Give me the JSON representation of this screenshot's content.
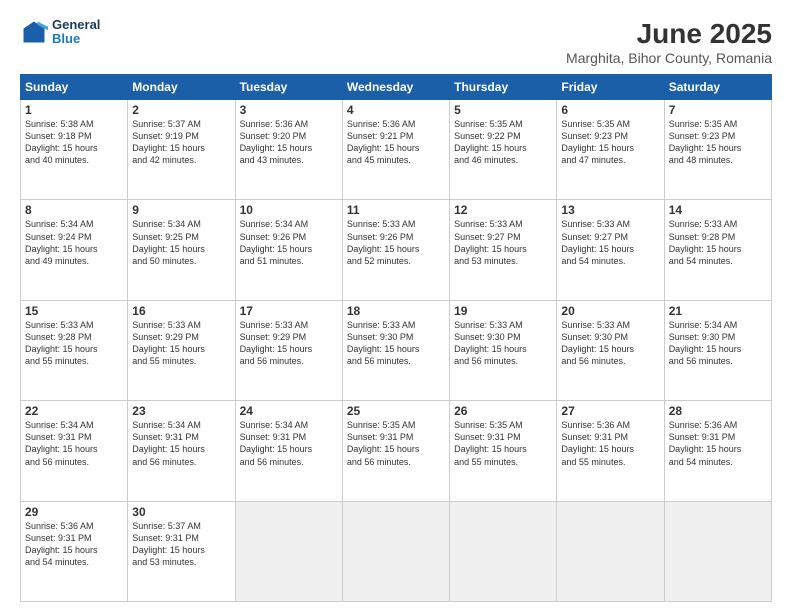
{
  "header": {
    "logo_general": "General",
    "logo_blue": "Blue",
    "title": "June 2025",
    "subtitle": "Marghita, Bihor County, Romania"
  },
  "calendar": {
    "days_of_week": [
      "Sunday",
      "Monday",
      "Tuesday",
      "Wednesday",
      "Thursday",
      "Friday",
      "Saturday"
    ],
    "weeks": [
      [
        {
          "day": "",
          "empty": true
        },
        {
          "day": "",
          "empty": true
        },
        {
          "day": "",
          "empty": true
        },
        {
          "day": "",
          "empty": true
        },
        {
          "day": "",
          "empty": true
        },
        {
          "day": "",
          "empty": true
        },
        {
          "day": "",
          "empty": true
        }
      ],
      [
        {
          "day": "1",
          "sunrise": "5:38 AM",
          "sunset": "9:18 PM",
          "daylight": "15 hours and 40 minutes."
        },
        {
          "day": "2",
          "sunrise": "5:37 AM",
          "sunset": "9:19 PM",
          "daylight": "15 hours and 42 minutes."
        },
        {
          "day": "3",
          "sunrise": "5:36 AM",
          "sunset": "9:20 PM",
          "daylight": "15 hours and 43 minutes."
        },
        {
          "day": "4",
          "sunrise": "5:36 AM",
          "sunset": "9:21 PM",
          "daylight": "15 hours and 45 minutes."
        },
        {
          "day": "5",
          "sunrise": "5:35 AM",
          "sunset": "9:22 PM",
          "daylight": "15 hours and 46 minutes."
        },
        {
          "day": "6",
          "sunrise": "5:35 AM",
          "sunset": "9:23 PM",
          "daylight": "15 hours and 47 minutes."
        },
        {
          "day": "7",
          "sunrise": "5:35 AM",
          "sunset": "9:23 PM",
          "daylight": "15 hours and 48 minutes."
        }
      ],
      [
        {
          "day": "8",
          "sunrise": "5:34 AM",
          "sunset": "9:24 PM",
          "daylight": "15 hours and 49 minutes."
        },
        {
          "day": "9",
          "sunrise": "5:34 AM",
          "sunset": "9:25 PM",
          "daylight": "15 hours and 50 minutes."
        },
        {
          "day": "10",
          "sunrise": "5:34 AM",
          "sunset": "9:26 PM",
          "daylight": "15 hours and 51 minutes."
        },
        {
          "day": "11",
          "sunrise": "5:33 AM",
          "sunset": "9:26 PM",
          "daylight": "15 hours and 52 minutes."
        },
        {
          "day": "12",
          "sunrise": "5:33 AM",
          "sunset": "9:27 PM",
          "daylight": "15 hours and 53 minutes."
        },
        {
          "day": "13",
          "sunrise": "5:33 AM",
          "sunset": "9:27 PM",
          "daylight": "15 hours and 54 minutes."
        },
        {
          "day": "14",
          "sunrise": "5:33 AM",
          "sunset": "9:28 PM",
          "daylight": "15 hours and 54 minutes."
        }
      ],
      [
        {
          "day": "15",
          "sunrise": "5:33 AM",
          "sunset": "9:28 PM",
          "daylight": "15 hours and 55 minutes."
        },
        {
          "day": "16",
          "sunrise": "5:33 AM",
          "sunset": "9:29 PM",
          "daylight": "15 hours and 55 minutes."
        },
        {
          "day": "17",
          "sunrise": "5:33 AM",
          "sunset": "9:29 PM",
          "daylight": "15 hours and 56 minutes."
        },
        {
          "day": "18",
          "sunrise": "5:33 AM",
          "sunset": "9:30 PM",
          "daylight": "15 hours and 56 minutes."
        },
        {
          "day": "19",
          "sunrise": "5:33 AM",
          "sunset": "9:30 PM",
          "daylight": "15 hours and 56 minutes."
        },
        {
          "day": "20",
          "sunrise": "5:33 AM",
          "sunset": "9:30 PM",
          "daylight": "15 hours and 56 minutes."
        },
        {
          "day": "21",
          "sunrise": "5:34 AM",
          "sunset": "9:30 PM",
          "daylight": "15 hours and 56 minutes."
        }
      ],
      [
        {
          "day": "22",
          "sunrise": "5:34 AM",
          "sunset": "9:31 PM",
          "daylight": "15 hours and 56 minutes."
        },
        {
          "day": "23",
          "sunrise": "5:34 AM",
          "sunset": "9:31 PM",
          "daylight": "15 hours and 56 minutes."
        },
        {
          "day": "24",
          "sunrise": "5:34 AM",
          "sunset": "9:31 PM",
          "daylight": "15 hours and 56 minutes."
        },
        {
          "day": "25",
          "sunrise": "5:35 AM",
          "sunset": "9:31 PM",
          "daylight": "15 hours and 56 minutes."
        },
        {
          "day": "26",
          "sunrise": "5:35 AM",
          "sunset": "9:31 PM",
          "daylight": "15 hours and 55 minutes."
        },
        {
          "day": "27",
          "sunrise": "5:36 AM",
          "sunset": "9:31 PM",
          "daylight": "15 hours and 55 minutes."
        },
        {
          "day": "28",
          "sunrise": "5:36 AM",
          "sunset": "9:31 PM",
          "daylight": "15 hours and 54 minutes."
        }
      ],
      [
        {
          "day": "29",
          "sunrise": "5:36 AM",
          "sunset": "9:31 PM",
          "daylight": "15 hours and 54 minutes."
        },
        {
          "day": "30",
          "sunrise": "5:37 AM",
          "sunset": "9:31 PM",
          "daylight": "15 hours and 53 minutes."
        },
        {
          "day": "",
          "empty": true
        },
        {
          "day": "",
          "empty": true
        },
        {
          "day": "",
          "empty": true
        },
        {
          "day": "",
          "empty": true
        },
        {
          "day": "",
          "empty": true
        }
      ]
    ]
  }
}
